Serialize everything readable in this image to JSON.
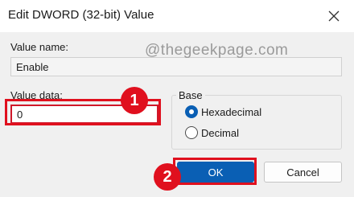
{
  "window": {
    "title": "Edit DWORD (32-bit) Value",
    "close_icon": "close-icon"
  },
  "value_name": {
    "label": "Value name:",
    "value": "Enable"
  },
  "value_data": {
    "label": "Value data:",
    "value": "0"
  },
  "base": {
    "label": "Base",
    "options": [
      {
        "label": "Hexadecimal",
        "selected": true
      },
      {
        "label": "Decimal",
        "selected": false
      }
    ]
  },
  "buttons": {
    "ok_label": "OK",
    "cancel_label": "Cancel"
  },
  "watermark": "@thegeekpage.com",
  "annotations": [
    {
      "number": "1",
      "target": "value-data-field"
    },
    {
      "number": "2",
      "target": "ok-button"
    }
  ],
  "colors": {
    "accent": "#0a5fb4",
    "annotation_red": "#e0101e",
    "background": "#f0f0f0"
  }
}
